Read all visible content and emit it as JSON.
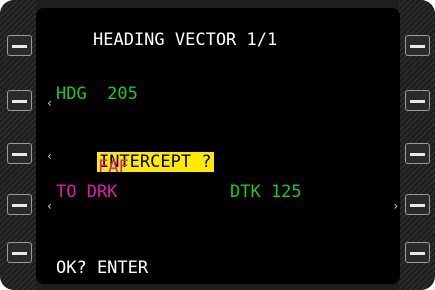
{
  "header": {
    "title": "HEADING VECTOR 1/1"
  },
  "lines": {
    "hdg": "HDG  205",
    "intercept": "INTERCEPT ?",
    "faf": "FAF",
    "to": "TO DRK",
    "dtk": "DTK 125",
    "prompt": "OK? ENTER"
  },
  "carets": {
    "left": "‹",
    "right": "›"
  },
  "colors": {
    "green": "#1ec81e",
    "magenta": "#e01aa8",
    "highlight": "#ffeb00",
    "white": "#ffffff"
  },
  "line_select_keys": {
    "left": [
      "line-select-key",
      "line-select-key",
      "line-select-key",
      "line-select-key",
      "line-select-key"
    ],
    "right": [
      "line-select-key",
      "line-select-key",
      "line-select-key",
      "line-select-key",
      "line-select-key"
    ]
  }
}
